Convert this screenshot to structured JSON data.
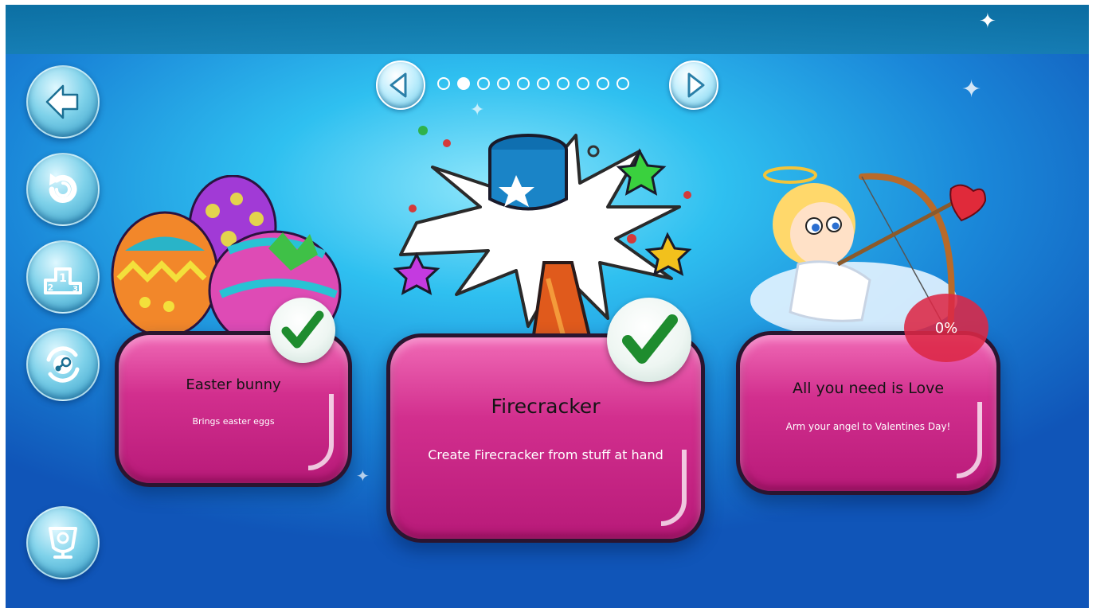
{
  "pager": {
    "page_count": 10,
    "active_index": 1
  },
  "achievements": [
    {
      "title": "Easter bunny",
      "description": "Brings easter eggs",
      "completed": true,
      "image": "easter-eggs"
    },
    {
      "title": "Firecracker",
      "description": "Create Firecracker from stuff at hand",
      "completed": true,
      "image": "exploding-firecracker"
    },
    {
      "title": "All you need is Love",
      "description": "Arm your angel to Valentines Day!",
      "completed": false,
      "progress_label": "0%",
      "image": "cupid-angel"
    }
  ],
  "sidebar": {
    "buttons": [
      "back-arrow-icon",
      "restart-icon",
      "leaderboard-podium-icon",
      "steam-sync-icon",
      "trophy-achievements-icon"
    ]
  },
  "colors": {
    "card": "#d22f8e",
    "background": "#2fc0f0",
    "check": "#1e8c2e",
    "progress_badge": "#dc2846"
  }
}
